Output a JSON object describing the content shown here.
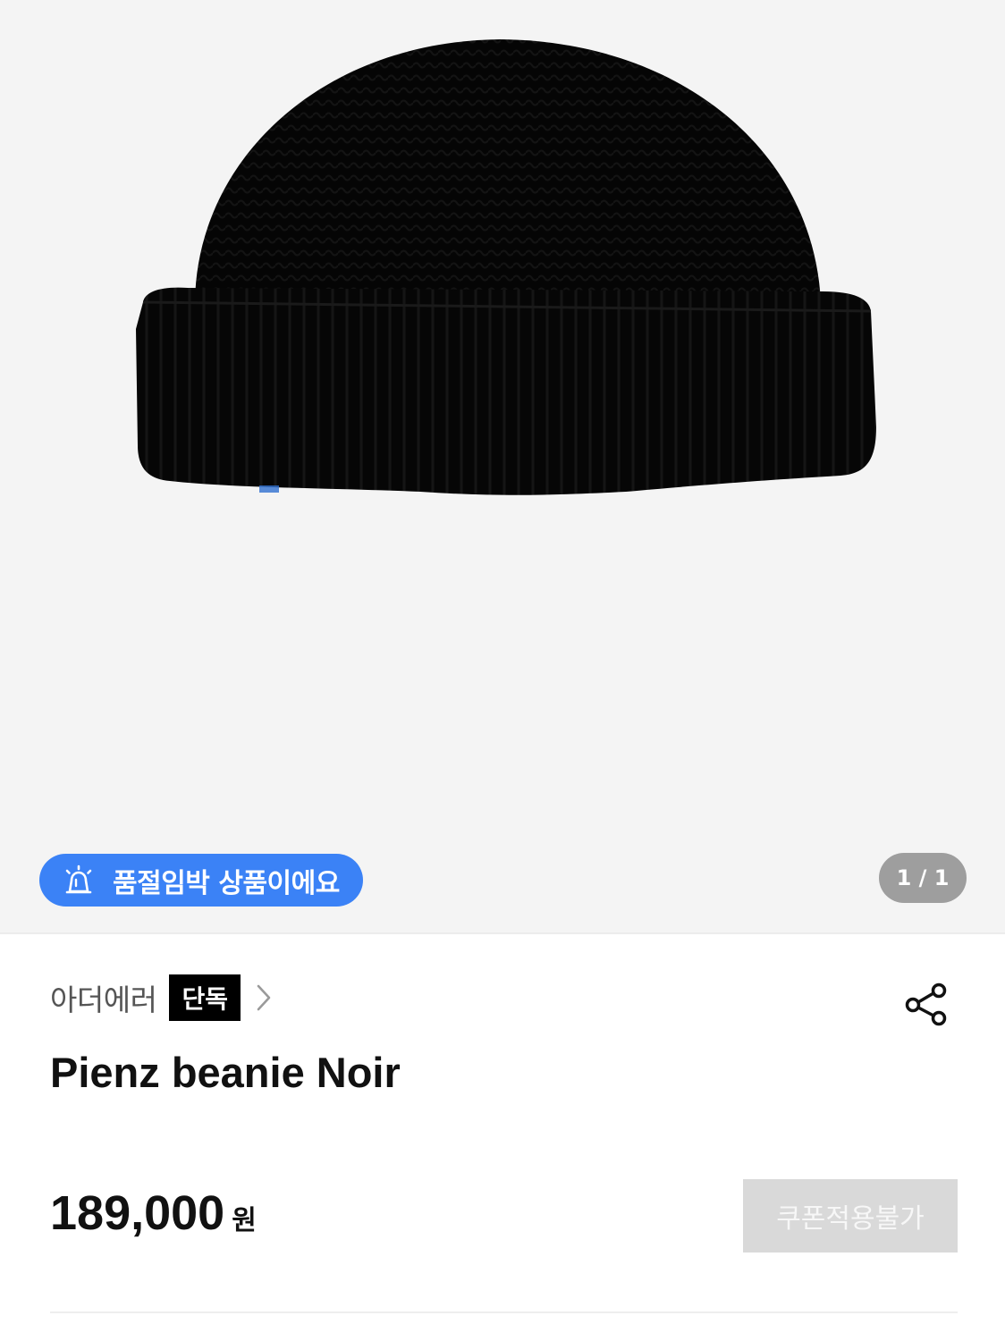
{
  "gallery": {
    "alert_badge": {
      "label": "품절임박 상품이에요",
      "icon": "siren-icon"
    },
    "counter": "1 / 1",
    "image_alt": "Pienz beanie Noir"
  },
  "brand": {
    "name": "아더에러",
    "exclusive_tag": "단독",
    "chevron_icon": "chevron-right-icon"
  },
  "share": {
    "icon": "share-icon"
  },
  "product": {
    "title": "Pienz beanie Noir",
    "price": "189,000",
    "price_unit": "원",
    "coupon_button": "쿠폰적용불가"
  },
  "colors": {
    "badge_blue": "#3b82f6",
    "counter_gray": "#9e9e9e",
    "coupon_disabled": "#d9d9d9",
    "gallery_bg": "#f4f4f4"
  }
}
